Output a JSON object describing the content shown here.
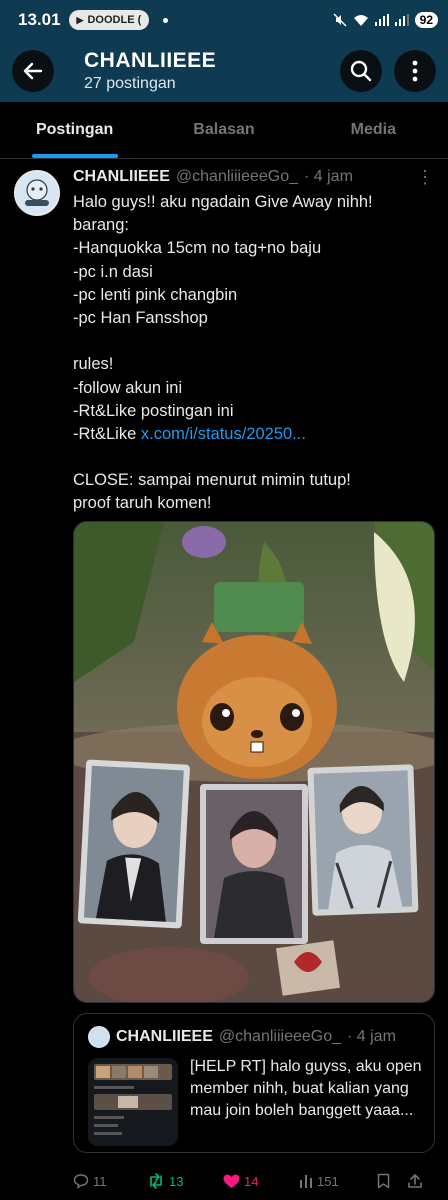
{
  "status_bar": {
    "time": "13.01",
    "app_pill": "DOODLE (",
    "battery": "92"
  },
  "header": {
    "title": "CHANLIIEEE",
    "subtitle": "27 postingan"
  },
  "tabs": [
    {
      "label": "Postingan",
      "active": true
    },
    {
      "label": "Balasan",
      "active": false
    },
    {
      "label": "Media",
      "active": false
    }
  ],
  "post": {
    "author_name": "CHANLIIEEE",
    "author_handle": "@chanliiieeeGo_",
    "time": "· 4 jam",
    "lines": [
      "Halo guys!! aku ngadain Give Away nihh!",
      "barang:",
      "-Hanquokka 15cm no tag+no baju",
      "-pc i.n dasi",
      "-pc lenti pink changbin",
      "-pc Han Fansshop",
      "",
      "rules!",
      "-follow akun ini",
      "-Rt&Like postingan ini",
      "-Rt&Like ",
      "",
      "CLOSE: sampai menurut mimin tutup!",
      "proof taruh komen!"
    ],
    "link_text": "x.com/i/status/20250..."
  },
  "quote": {
    "author_name": "CHANLIIEEE",
    "author_handle": "@chanliiieeeGo_",
    "time": "· 4 jam",
    "text": "[HELP RT] halo guyss, aku open member nihh, buat kalian yang mau join boleh banggett yaaa..."
  },
  "actions": {
    "replies": "11",
    "reposts": "13",
    "likes": "14",
    "views": "151"
  },
  "colors": {
    "header_bg": "#0e3a52",
    "accent": "#1d9bf0",
    "repost_green": "#00ba7c",
    "like_pink": "#f91880"
  }
}
